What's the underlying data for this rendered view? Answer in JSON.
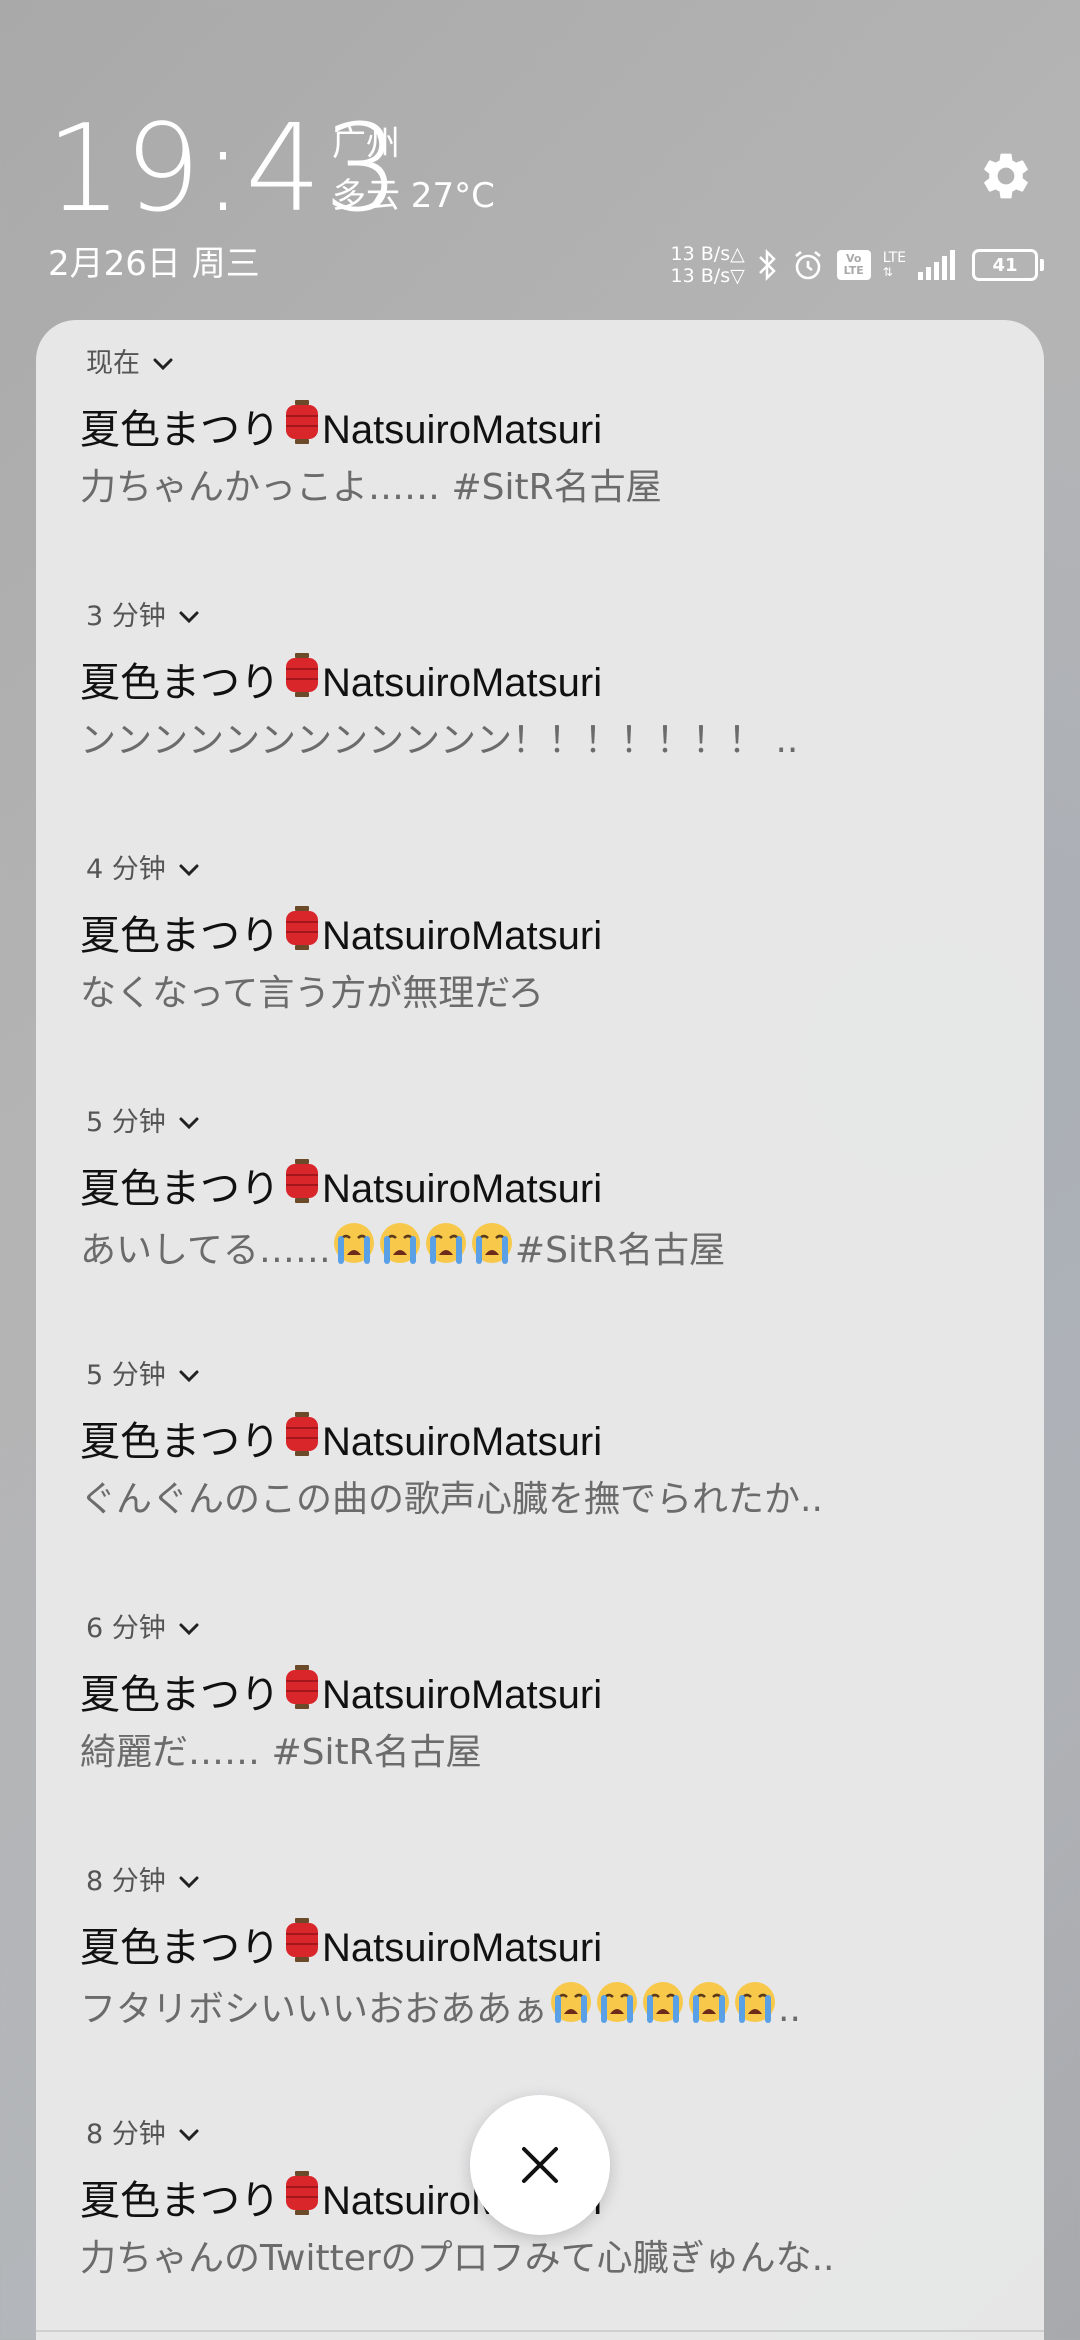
{
  "header": {
    "time": "19:43",
    "city": "广州",
    "weather": "多云 27°C",
    "date": "2月26日 周三"
  },
  "status_bar": {
    "net_up": "13 B/s△",
    "net_down": "13 B/s▽",
    "lte_label": "LTE",
    "volte_label": "Vo LTE",
    "battery": "41",
    "icons": [
      "bluetooth-icon",
      "alarm-icon",
      "volte-icon",
      "signal-icon",
      "battery-icon"
    ]
  },
  "notifications": [
    {
      "time": "现在",
      "title_jp": "夏色まつり",
      "title_en": "NatsuiroMatsuri",
      "body": "力ちゃんかっこよ…… #SitR名古屋",
      "cry": 0,
      "body_after": ""
    },
    {
      "time": "3 分钟",
      "title_jp": "夏色まつり",
      "title_en": "NatsuiroMatsuri",
      "body": "ンンンンンンンンンンンン！！！！！！！ ..",
      "cry": 0,
      "body_after": ""
    },
    {
      "time": "4 分钟",
      "title_jp": "夏色まつり",
      "title_en": "NatsuiroMatsuri",
      "body": "なくなって言う方が無理だろ",
      "cry": 0,
      "body_after": ""
    },
    {
      "time": "5 分钟",
      "title_jp": "夏色まつり",
      "title_en": "NatsuiroMatsuri",
      "body": "あいしてる……",
      "cry": 4,
      "body_after": " #SitR名古屋"
    },
    {
      "time": "5 分钟",
      "title_jp": "夏色まつり",
      "title_en": "NatsuiroMatsuri",
      "body": "ぐんぐんのこの曲の歌声心臓を撫でられたか..",
      "cry": 0,
      "body_after": ""
    },
    {
      "time": "6 分钟",
      "title_jp": "夏色まつり",
      "title_en": "NatsuiroMatsuri",
      "body": "綺麗だ…… #SitR名古屋",
      "cry": 0,
      "body_after": ""
    },
    {
      "time": "8 分钟",
      "title_jp": "夏色まつり",
      "title_en": "NatsuiroMatsuri",
      "body": "フタリボシいいいおおああぁ",
      "cry": 5,
      "body_after": ".."
    },
    {
      "time": "8 分钟",
      "title_jp": "夏色まつり",
      "title_en": "NatsuiroMatsuri",
      "body": "力ちゃんのTwitterのプロフみて心臓ぎゅんな..",
      "cry": 0,
      "body_after": ""
    }
  ],
  "colors": {
    "panel": "#ececec",
    "title_text": "#111111",
    "body_text": "#6b6b6b",
    "lantern": "#d9262b"
  }
}
